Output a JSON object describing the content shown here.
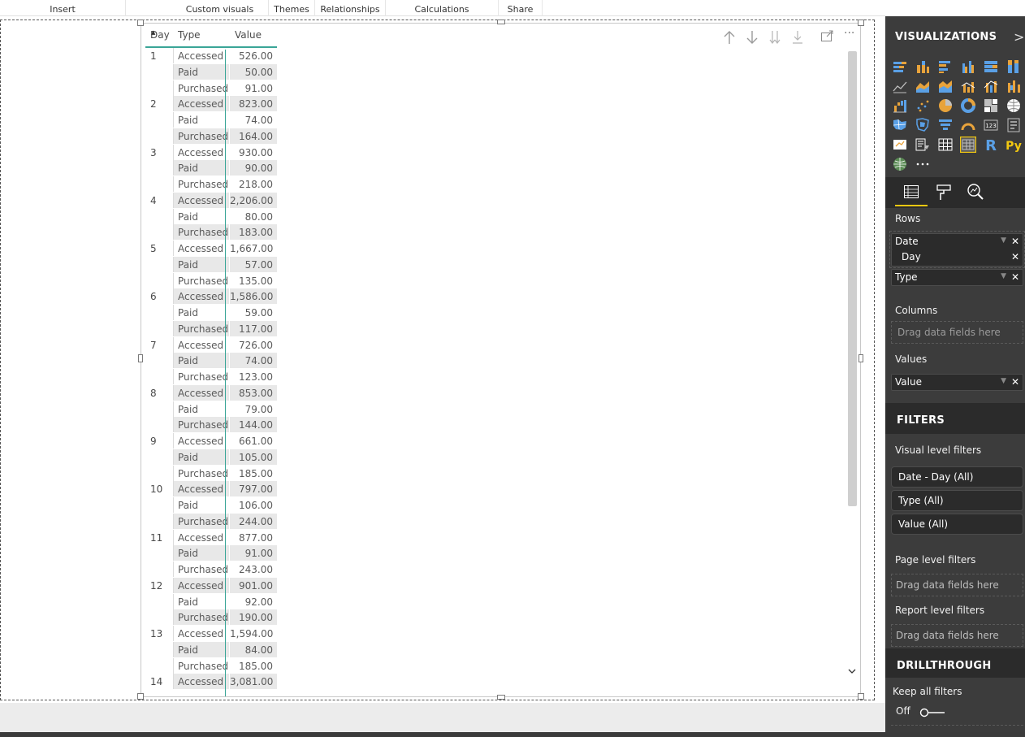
{
  "ribbon": {
    "groups": [
      "Insert",
      "Custom visuals",
      "Themes",
      "Relationships",
      "Calculations",
      "Share"
    ]
  },
  "table": {
    "headers": {
      "day": "Day",
      "type": "Type",
      "value": "Value"
    },
    "rows": [
      {
        "day": "1",
        "type": "Accessed",
        "value": "526.00"
      },
      {
        "day": "",
        "type": "Paid",
        "value": "50.00"
      },
      {
        "day": "",
        "type": "Purchased",
        "value": "91.00"
      },
      {
        "day": "2",
        "type": "Accessed",
        "value": "823.00"
      },
      {
        "day": "",
        "type": "Paid",
        "value": "74.00"
      },
      {
        "day": "",
        "type": "Purchased",
        "value": "164.00"
      },
      {
        "day": "3",
        "type": "Accessed",
        "value": "930.00"
      },
      {
        "day": "",
        "type": "Paid",
        "value": "90.00"
      },
      {
        "day": "",
        "type": "Purchased",
        "value": "218.00"
      },
      {
        "day": "4",
        "type": "Accessed",
        "value": "2,206.00"
      },
      {
        "day": "",
        "type": "Paid",
        "value": "80.00"
      },
      {
        "day": "",
        "type": "Purchased",
        "value": "183.00"
      },
      {
        "day": "5",
        "type": "Accessed",
        "value": "1,667.00"
      },
      {
        "day": "",
        "type": "Paid",
        "value": "57.00"
      },
      {
        "day": "",
        "type": "Purchased",
        "value": "135.00"
      },
      {
        "day": "6",
        "type": "Accessed",
        "value": "1,586.00"
      },
      {
        "day": "",
        "type": "Paid",
        "value": "59.00"
      },
      {
        "day": "",
        "type": "Purchased",
        "value": "117.00"
      },
      {
        "day": "7",
        "type": "Accessed",
        "value": "726.00"
      },
      {
        "day": "",
        "type": "Paid",
        "value": "74.00"
      },
      {
        "day": "",
        "type": "Purchased",
        "value": "123.00"
      },
      {
        "day": "8",
        "type": "Accessed",
        "value": "853.00"
      },
      {
        "day": "",
        "type": "Paid",
        "value": "79.00"
      },
      {
        "day": "",
        "type": "Purchased",
        "value": "144.00"
      },
      {
        "day": "9",
        "type": "Accessed",
        "value": "661.00"
      },
      {
        "day": "",
        "type": "Paid",
        "value": "105.00"
      },
      {
        "day": "",
        "type": "Purchased",
        "value": "185.00"
      },
      {
        "day": "10",
        "type": "Accessed",
        "value": "797.00"
      },
      {
        "day": "",
        "type": "Paid",
        "value": "106.00"
      },
      {
        "day": "",
        "type": "Purchased",
        "value": "244.00"
      },
      {
        "day": "11",
        "type": "Accessed",
        "value": "877.00"
      },
      {
        "day": "",
        "type": "Paid",
        "value": "91.00"
      },
      {
        "day": "",
        "type": "Purchased",
        "value": "243.00"
      },
      {
        "day": "12",
        "type": "Accessed",
        "value": "901.00"
      },
      {
        "day": "",
        "type": "Paid",
        "value": "92.00"
      },
      {
        "day": "",
        "type": "Purchased",
        "value": "190.00"
      },
      {
        "day": "13",
        "type": "Accessed",
        "value": "1,594.00"
      },
      {
        "day": "",
        "type": "Paid",
        "value": "84.00"
      },
      {
        "day": "",
        "type": "Purchased",
        "value": "185.00"
      },
      {
        "day": "14",
        "type": "Accessed",
        "value": "3,081.00"
      }
    ]
  },
  "visual_toolbar": {
    "icons": [
      "drill-up-icon",
      "drill-down-icon",
      "expand-all-icon",
      "expand-next-level-icon",
      "focus-mode-icon",
      "more-options-icon"
    ]
  },
  "visualizations": {
    "title": "VISUALIZATIONS",
    "collapse_glyph": ">",
    "more_glyph": "···",
    "r_label": "R",
    "py_label": "Py",
    "card_label": "123"
  },
  "fields": {
    "rows_label": "Rows",
    "rows": [
      {
        "name": "Date"
      },
      {
        "name": "Day"
      },
      {
        "name": "Type"
      }
    ],
    "columns_label": "Columns",
    "columns_placeholder": "Drag data fields here",
    "values_label": "Values",
    "values": [
      {
        "name": "Value"
      }
    ]
  },
  "filters": {
    "title": "FILTERS",
    "visual_label": "Visual level filters",
    "visual_items": [
      "Date - Day (All)",
      "Type (All)",
      "Value (All)"
    ],
    "page_label": "Page level filters",
    "page_placeholder": "Drag data fields here",
    "report_label": "Report level filters",
    "report_placeholder": "Drag data fields here"
  },
  "drillthrough": {
    "title": "DRILLTHROUGH",
    "keep_label": "Keep all filters",
    "toggle_state": "Off"
  },
  "colors": {
    "accent": "#3aa597",
    "pane_bg": "#3c3c3c",
    "highlight": "#f2c811"
  }
}
